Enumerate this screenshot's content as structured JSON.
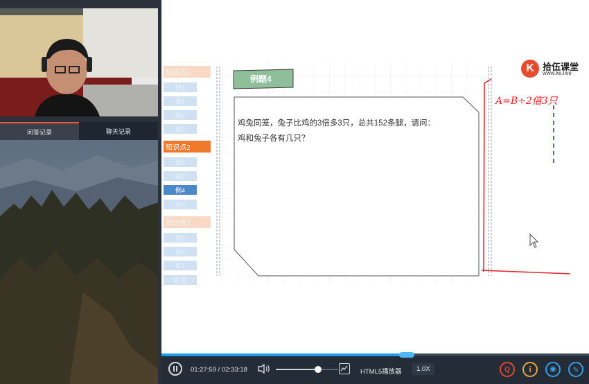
{
  "sidebar": {
    "tabs": [
      {
        "label": "问答记录",
        "active": true
      },
      {
        "label": "聊天记录",
        "active": false
      }
    ]
  },
  "slide": {
    "brand_name": "拾伍课堂",
    "brand_url": "www.ke.live",
    "brand_logo": "K",
    "example_title": "例题4",
    "problem_line1": "鸡兔同笼，兔子比鸡的3倍多3只，总共152条腿，请问：",
    "problem_line2": "鸡和兔子各有几只？",
    "handwriting": "A=B÷2倍3只",
    "nav": [
      {
        "label": "知识点1",
        "type": "kp",
        "active": false
      },
      {
        "label": "例1",
        "type": "ex",
        "active": false
      },
      {
        "label": "练1",
        "type": "ex",
        "active": false
      },
      {
        "label": "例2",
        "type": "ex",
        "active": false
      },
      {
        "label": "练2",
        "type": "ex",
        "active": false
      },
      {
        "label": "知识点2",
        "type": "kp",
        "active": true
      },
      {
        "label": "例3",
        "type": "ex",
        "active": false
      },
      {
        "label": "练3",
        "type": "ex",
        "active": false
      },
      {
        "label": "例4",
        "type": "ex",
        "active": true
      },
      {
        "label": "练4",
        "type": "ex",
        "active": false
      },
      {
        "label": "知识点3",
        "type": "kp",
        "active": false
      },
      {
        "label": "例5",
        "type": "ex",
        "active": false
      },
      {
        "label": "例6",
        "type": "ex",
        "active": false
      },
      {
        "label": "练1",
        "type": "ex",
        "active": false
      },
      {
        "label": "补充",
        "type": "ex",
        "active": false
      }
    ]
  },
  "player": {
    "current_time": "01:27:59",
    "separator": "/",
    "total_time": "02:33:18",
    "playback_progress": 0.574,
    "volume_level": 0.68,
    "player_label": "HTML5播放器",
    "speed": "1.0X",
    "icons": [
      "pause-icon",
      "volume-icon",
      "screen-icon",
      "qa-icon",
      "info-icon",
      "settings-icon",
      "pen-icon"
    ],
    "colors": {
      "accent": "#f15a31",
      "progress": "#1e9be9",
      "handwriting": "#e8232b"
    }
  }
}
